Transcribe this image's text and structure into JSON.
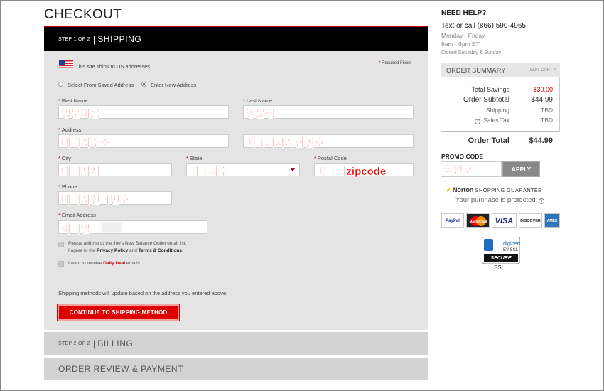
{
  "page": {
    "title": "CHECKOUT"
  },
  "step1": {
    "step_label": "STEP 1 OF 2",
    "separator": "|",
    "name": "SHIPPING"
  },
  "step2": {
    "step_label": "STEP 2 OF 2",
    "separator": "|",
    "name": "BILLING"
  },
  "step3": {
    "name": "ORDER REVIEW & PAYMENT"
  },
  "shipping": {
    "ships_notice": "This site ships to US addresses.",
    "required_note": "Required Fields",
    "radio_saved": "Select From Saved Address",
    "radio_new": "Enter New Address",
    "selected_option": "Enter New Address",
    "fields": {
      "first_name": {
        "label": "First Name",
        "value": "영문이름"
      },
      "last_name": {
        "label": "Last Name",
        "value": "영문성"
      },
      "address": {
        "label": "Address",
        "value": "배대지주소"
      },
      "address2": {
        "label": "",
        "value": "배대지사서함번호"
      },
      "city": {
        "label": "City",
        "value": "배대지시"
      },
      "state": {
        "label": "State",
        "value": "배대지주"
      },
      "postal": {
        "label": "Postal Code",
        "value": "배대지zipcode"
      },
      "phone": {
        "label": "Phone",
        "value": "배대지전화번호"
      },
      "email": {
        "label": "Email Address",
        "value": "이메일"
      }
    },
    "optin_email_line1": "Please add me to the Joe's New Balance Outlet email list.",
    "optin_email_line2_pre": "I agree to the",
    "optin_privacy": "Privacy Policy",
    "optin_and": "and",
    "optin_terms": "Terms & Conditions",
    "optin_daily_pre": "I want to receive",
    "optin_daily": "Daily Deal",
    "optin_daily_post": "emails.",
    "update_note": "Shipping methods will update based on the address you entered above.",
    "continue_label": "CONTINUE TO SHIPPING METHOD"
  },
  "help": {
    "title": "NEED HELP?",
    "phone_line": "Text or call (866) 590-4965",
    "days": "Monday - Friday",
    "hours": "9am - 6pm ET",
    "closed": "Closed Saturday & Sunday"
  },
  "summary": {
    "title": "ORDER SUMMARY",
    "edit_cart": "EDIT CART",
    "total_savings_label": "Total Savings",
    "total_savings_value": "-$30.00",
    "subtotal_label": "Order Subtotal",
    "subtotal_value": "$44.99",
    "shipping_label": "Shipping",
    "shipping_value": "TBD",
    "tax_label": "Sales Tax",
    "tax_value": "TBD",
    "order_total_label": "Order Total",
    "order_total_value": "$44.99"
  },
  "promo": {
    "title": "PROMO CODE",
    "value": "할인코드",
    "apply_label": "APPLY"
  },
  "norton": {
    "brand": "Norton",
    "guarantee": "SHOPPING GUARANTEE",
    "sub": "Your purchase is protected"
  },
  "cards": [
    "PayPal",
    "MasterCard",
    "VISA",
    "DISCOVER",
    "AMEX"
  ],
  "ssl": {
    "brand": "digicert",
    "ev": "EV SSL",
    "secure": "SECURE",
    "label": "SSL"
  },
  "colors": {
    "accent": "#cc0000",
    "header_bg": "#000000",
    "panel_bg": "#e4e4e4"
  }
}
